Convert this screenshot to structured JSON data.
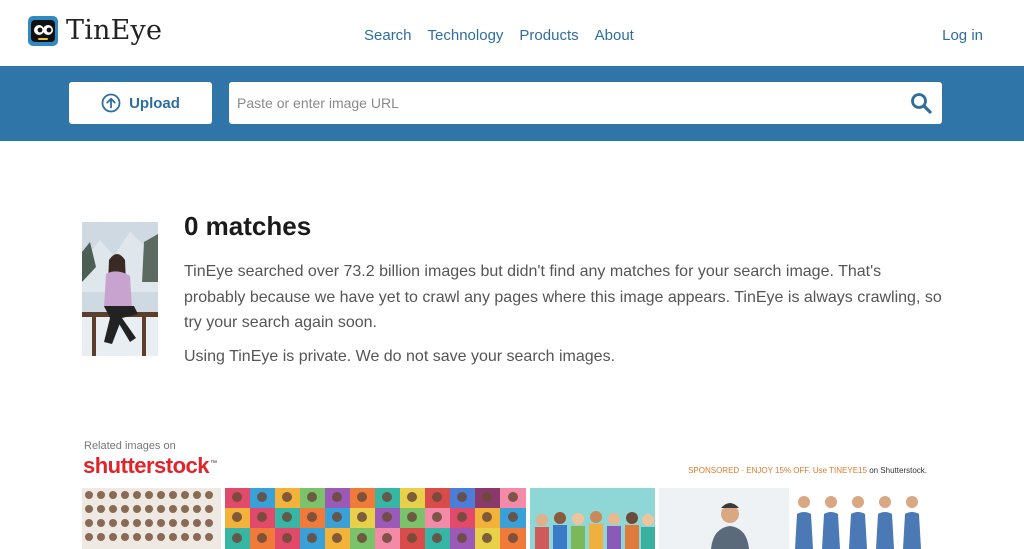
{
  "brand": {
    "name": "TinEye"
  },
  "nav": {
    "items": [
      "Search",
      "Technology",
      "Products",
      "About"
    ],
    "login": "Log in"
  },
  "search": {
    "upload_label": "Upload",
    "url_placeholder": "Paste or enter image URL",
    "url_value": ""
  },
  "result": {
    "title": "0 matches",
    "message": "TinEye searched over 73.2 billion images but didn't find any matches for your search image. That's probably because we have yet to crawl any pages where this image appears. TinEye is always crawling, so try your search again soon.",
    "privacy": "Using TinEye is private. We do not save your search images."
  },
  "sponsored": {
    "related_label": "Related images on",
    "partner_name": "shutterstock",
    "partner_mark": "™",
    "promo_prefix": "SPONSORED · ENJOY 15% OFF. Use",
    "promo_code": "TINEYE15",
    "promo_suffix": "on Shutterstock."
  },
  "colors": {
    "header_band": "#2f75a8",
    "link": "#2e6e9e",
    "shutterstock_red": "#e0242a"
  },
  "icons": {
    "upload": "arrow-up-circle-icon",
    "search": "magnifier-icon",
    "logo": "tineye-robot-logo"
  }
}
